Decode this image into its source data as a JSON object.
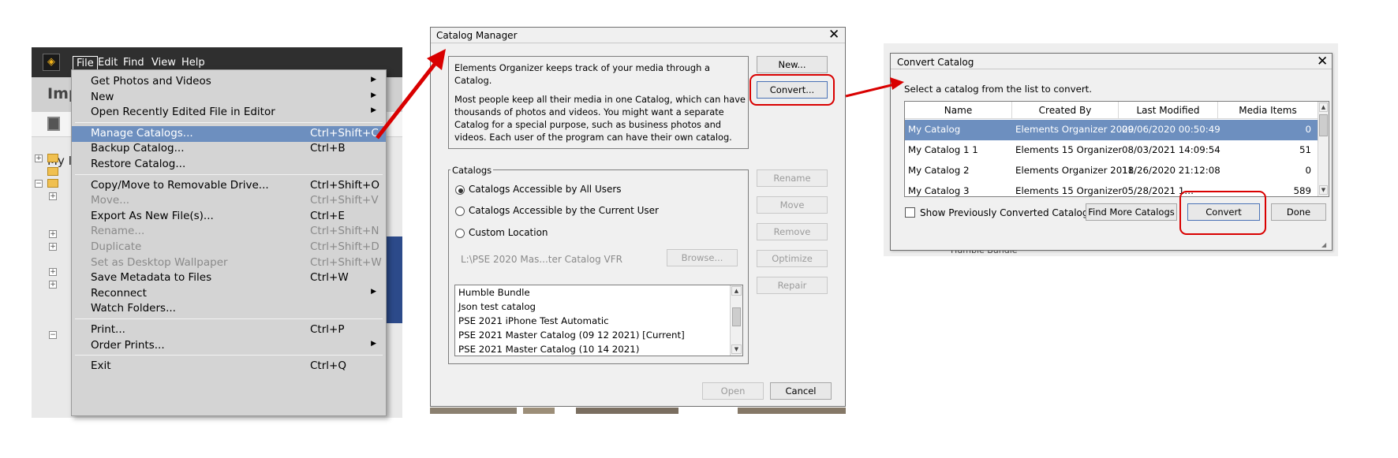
{
  "organizer": {
    "menubar": [
      "File",
      "Edit",
      "Find",
      "View",
      "Help"
    ],
    "import_label": "Imp",
    "my_label": "My I"
  },
  "file_menu": {
    "items": [
      {
        "label": "Get Photos and Videos",
        "shortcut": "",
        "submenu": true,
        "disabled": false
      },
      {
        "label": "New",
        "shortcut": "",
        "submenu": true,
        "disabled": false
      },
      {
        "label": "Open Recently Edited File in Editor",
        "shortcut": "",
        "submenu": true,
        "disabled": false
      },
      {
        "label": "Manage Catalogs...",
        "shortcut": "Ctrl+Shift+C",
        "submenu": false,
        "disabled": false,
        "selected": true
      },
      {
        "label": "Backup Catalog...",
        "shortcut": "Ctrl+B",
        "submenu": false,
        "disabled": false
      },
      {
        "label": "Restore Catalog...",
        "shortcut": "",
        "submenu": false,
        "disabled": false
      },
      {
        "label": "Copy/Move to Removable Drive...",
        "shortcut": "Ctrl+Shift+O",
        "submenu": false,
        "disabled": false
      },
      {
        "label": "Move...",
        "shortcut": "Ctrl+Shift+V",
        "submenu": false,
        "disabled": true
      },
      {
        "label": "Export As New File(s)...",
        "shortcut": "Ctrl+E",
        "submenu": false,
        "disabled": false
      },
      {
        "label": "Rename...",
        "shortcut": "Ctrl+Shift+N",
        "submenu": false,
        "disabled": true
      },
      {
        "label": "Duplicate",
        "shortcut": "Ctrl+Shift+D",
        "submenu": false,
        "disabled": true
      },
      {
        "label": "Set as Desktop Wallpaper",
        "shortcut": "Ctrl+Shift+W",
        "submenu": false,
        "disabled": true
      },
      {
        "label": "Save Metadata to Files",
        "shortcut": "Ctrl+W",
        "submenu": false,
        "disabled": false
      },
      {
        "label": "Reconnect",
        "shortcut": "",
        "submenu": true,
        "disabled": false
      },
      {
        "label": "Watch Folders...",
        "shortcut": "",
        "submenu": false,
        "disabled": false
      },
      {
        "label": "Print...",
        "shortcut": "Ctrl+P",
        "submenu": false,
        "disabled": false
      },
      {
        "label": "Order Prints...",
        "shortcut": "",
        "submenu": true,
        "disabled": false
      },
      {
        "label": "Exit",
        "shortcut": "Ctrl+Q",
        "submenu": false,
        "disabled": false
      }
    ]
  },
  "catalog_manager": {
    "title": "Catalog Manager",
    "info_line1": "Elements Organizer keeps track of your media through a",
    "info_line2": "Catalog.",
    "info_line3": "Most people keep all their media in one Catalog, which can have",
    "info_line4": "thousands of photos and videos. You might want a separate",
    "info_line5": "Catalog for a special purpose, such as business photos and",
    "info_line6": "videos. Each user of the program can have their own catalog.",
    "btn_new": "New...",
    "btn_convert": "Convert...",
    "catalogs_legend": "Catalogs",
    "radio_all": "Catalogs Accessible by All Users",
    "radio_current": "Catalogs Accessible by the Current User",
    "radio_custom": "Custom Location",
    "path": "L:\\PSE 2020 Mas...ter Catalog VFR",
    "btn_browse": "Browse...",
    "btn_rename": "Rename",
    "btn_move": "Move",
    "btn_remove": "Remove",
    "btn_optimize": "Optimize",
    "btn_repair": "Repair",
    "catalog_list": [
      "Humble Bundle",
      "Json test catalog",
      "PSE 2021 iPhone Test Automatic",
      "PSE 2021 Master Catalog (09 12 2021) [Current]",
      "PSE 2021 Master Catalog (10 14 2021)"
    ],
    "btn_open": "Open",
    "btn_cancel": "Cancel"
  },
  "convert_catalog": {
    "title": "Convert Catalog",
    "instruction": "Select a catalog from the list to convert.",
    "columns": [
      "Name",
      "Created By",
      "Last Modified",
      "Media Items"
    ],
    "rows": [
      {
        "name": "My Catalog",
        "created_by": "Elements Organizer 2020",
        "last_modified": "09/06/2020 00:50:49",
        "media_items": "0"
      },
      {
        "name": "My Catalog 1 1",
        "created_by": "Elements 15 Organizer",
        "last_modified": "08/03/2021 14:09:54",
        "media_items": "51"
      },
      {
        "name": "My Catalog 2",
        "created_by": "Elements Organizer 2018",
        "last_modified": "11/26/2020 21:12:08",
        "media_items": "0"
      },
      {
        "name": "My Catalog 3",
        "created_by": "Elements 15 Organizer",
        "last_modified": "05/28/2021 1…",
        "media_items": "589"
      }
    ],
    "show_converted_label": "Show Previously Converted Catalogs",
    "btn_find_more": "Find More Catalogs",
    "btn_convert": "Convert",
    "btn_done": "Done",
    "background_peek": "Humble Bundle"
  },
  "colors": {
    "highlight": "#d90000",
    "selection": "#6d8fbf",
    "organizer_bar": "#2f2f2f"
  }
}
